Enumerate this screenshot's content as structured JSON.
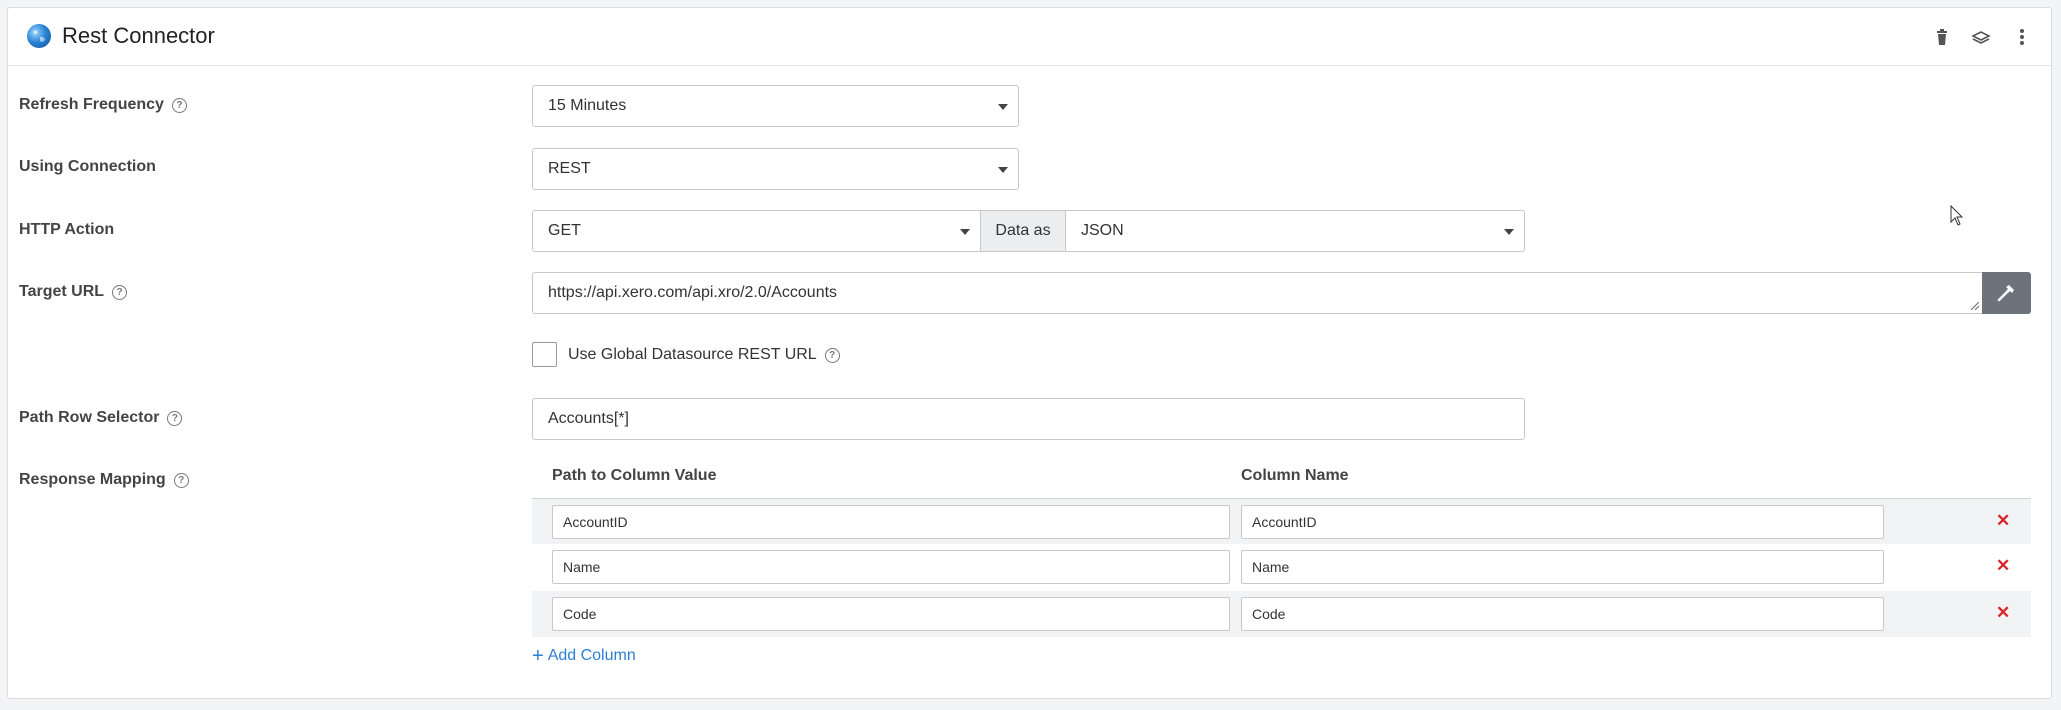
{
  "header": {
    "title": "Rest Connector"
  },
  "fields": {
    "refresh_frequency": {
      "label": "Refresh Frequency",
      "value": "15 Minutes"
    },
    "using_connection": {
      "label": "Using Connection",
      "value": "REST"
    },
    "http_action": {
      "label": "HTTP Action",
      "value": "GET",
      "data_as_label": "Data as",
      "data_as_value": "JSON"
    },
    "target_url": {
      "label": "Target URL",
      "value": "https://api.xero.com/api.xro/2.0/Accounts"
    },
    "use_global": {
      "label": "Use Global Datasource REST URL",
      "checked": false
    },
    "path_row_selector": {
      "label": "Path Row Selector",
      "value": "Accounts[*]"
    }
  },
  "response_mapping": {
    "label": "Response Mapping",
    "col_path": "Path to Column Value",
    "col_name": "Column Name",
    "rows": [
      {
        "path": "AccountID",
        "name": "AccountID"
      },
      {
        "path": "Name",
        "name": "Name"
      },
      {
        "path": "Code",
        "name": "Code"
      }
    ],
    "add_column": "Add Column"
  },
  "colors": {
    "accent": "#2c7fd6",
    "remove": "#d9262a",
    "button": "#6c737a"
  },
  "help_glyph": "?"
}
